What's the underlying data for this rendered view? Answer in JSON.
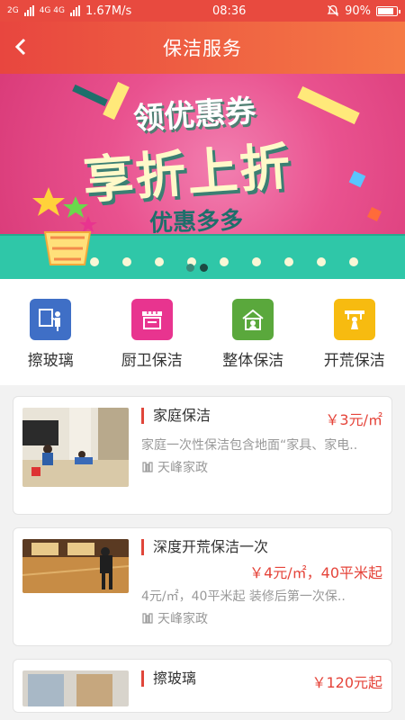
{
  "status_bar": {
    "network_left": "2G",
    "network_4g": "4G 4G",
    "speed": "1.67M/s",
    "time": "08:36",
    "battery": "90%"
  },
  "nav": {
    "title": "保洁服务"
  },
  "banner": {
    "line1": "领优惠券",
    "line2": "享折上折",
    "line3": "优惠多多",
    "slide_index": 2,
    "slide_count": 2
  },
  "categories": [
    {
      "label": "擦玻璃",
      "icon": "person-window-icon",
      "color": "#3f6fc6"
    },
    {
      "label": "厨卫保洁",
      "icon": "kitchen-icon",
      "color": "#e8348f"
    },
    {
      "label": "整体保洁",
      "icon": "house-clean-icon",
      "color": "#5aa83c"
    },
    {
      "label": "开荒保洁",
      "icon": "broom-icon",
      "color": "#f7bb10"
    }
  ],
  "services": [
    {
      "name": "家庭保洁",
      "price": "￥3元/㎡",
      "desc": "家庭一次性保洁包含地面“家具、家电..",
      "shop": "天峰家政"
    },
    {
      "name": "深度开荒保洁一次",
      "price": "￥4元/㎡，40平米起",
      "desc": "4元/㎡，40平米起 装修后第一次保..",
      "shop": "天峰家政"
    },
    {
      "name": "擦玻璃",
      "price": "￥120元起",
      "desc": "",
      "shop": ""
    }
  ]
}
